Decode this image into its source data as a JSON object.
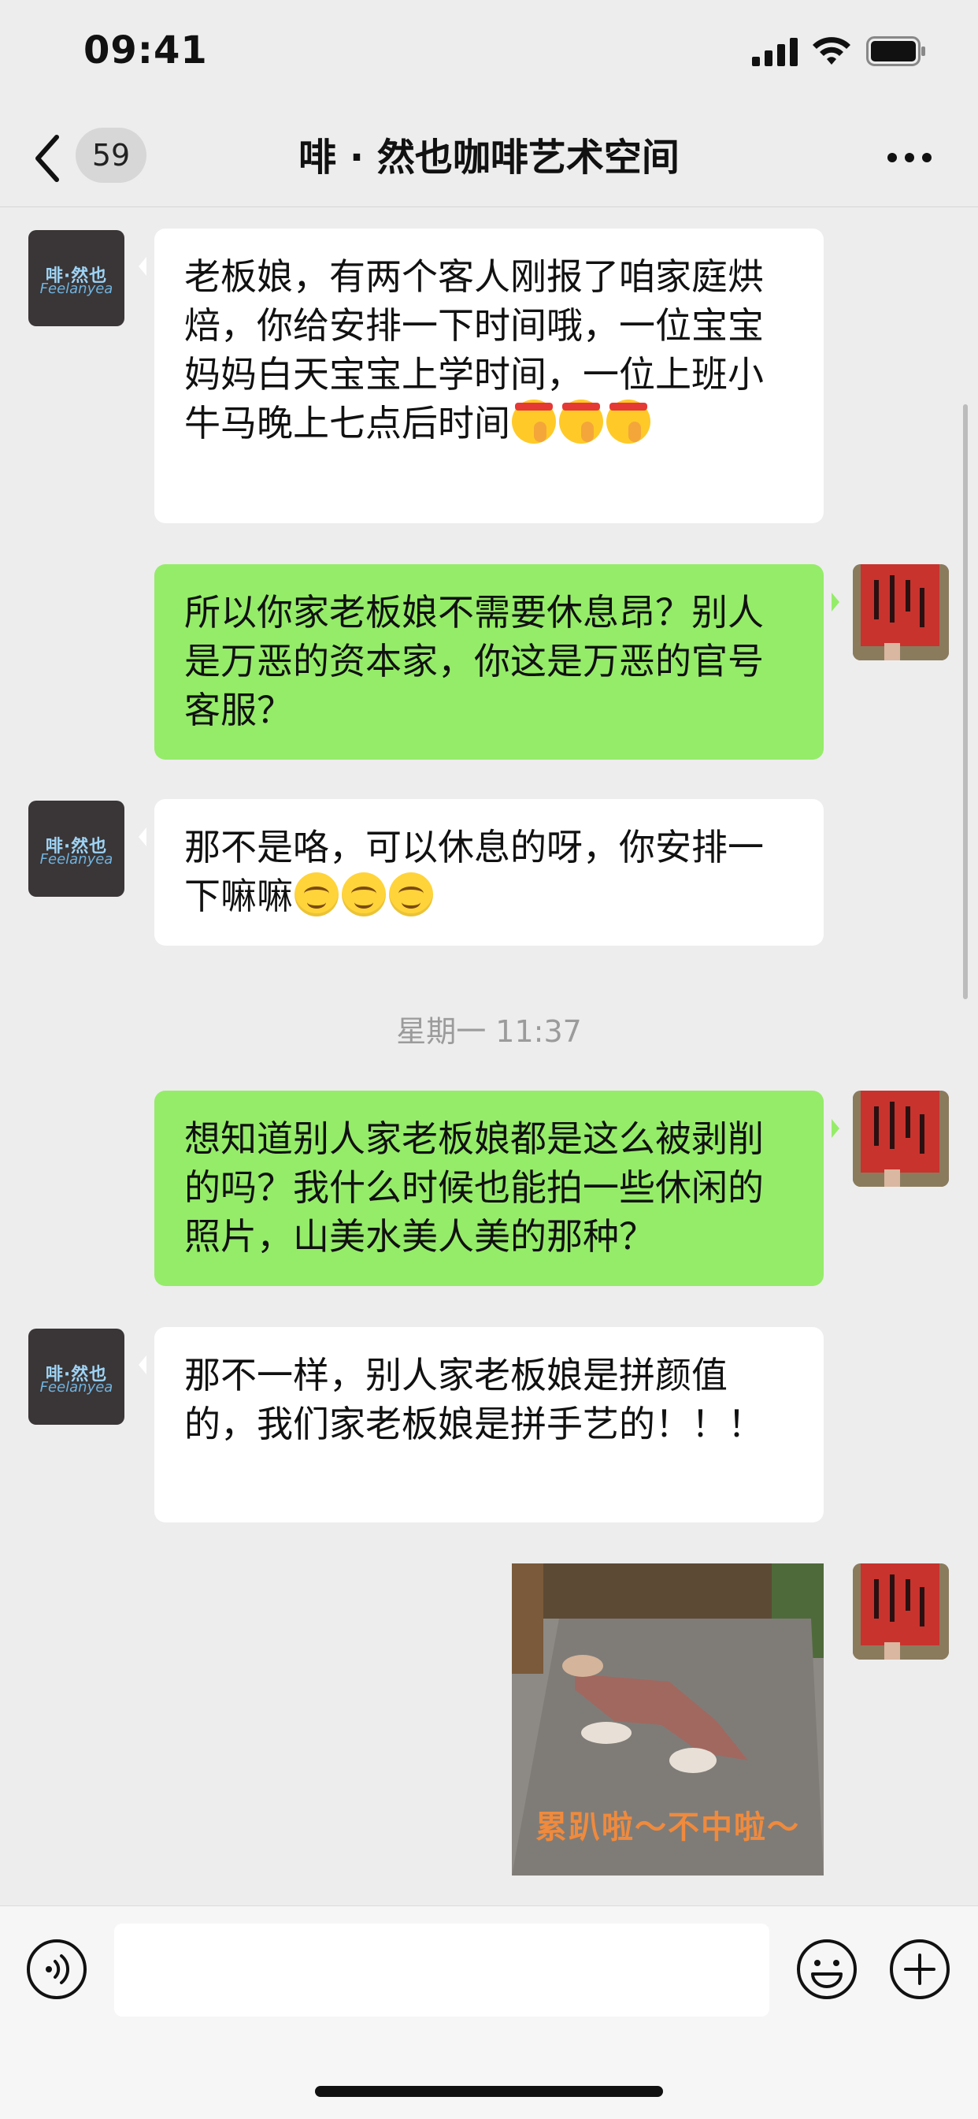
{
  "status_bar": {
    "time": "09:41"
  },
  "nav": {
    "back_icon": "chevron-left-icon",
    "unread_count": "59",
    "title": "啡 · 然也咖啡艺术空间",
    "more_icon": "more-dots-icon"
  },
  "contact_avatar": {
    "logo_cn": "啡·然也",
    "logo_en": "Feelanyea"
  },
  "messages": [
    {
      "side": "left",
      "text": "老板娘，有两个客人刚报了咱家庭烘焙，你给安排一下时间哦，一位宝宝妈妈白天宝宝上学时间，一位上班小牛马晚上七点后时间"
    },
    {
      "side": "right",
      "text": "所以你家老板娘不需要休息昂？别人是万恶的资本家，你这是万恶的官号客服？"
    },
    {
      "side": "left",
      "text": "那不是咯，可以休息的呀，你安排一下嘛嘛"
    },
    {
      "side": "right",
      "text": "想知道别人家老板娘都是这么被剥削的吗？我什么时候也能拍一些休闲的照片，山美水美人美的那种？"
    },
    {
      "side": "left",
      "text": "那不一样，别人家老板娘是拼颜值的，我们家老板娘是拼手艺的！！！"
    },
    {
      "side": "right",
      "type": "image",
      "caption": "累趴啦～不中啦～"
    }
  ],
  "timestamp": "星期一 11:37",
  "input_bar": {
    "voice_icon": "voice-icon",
    "emoji_icon": "emoji-icon",
    "plus_icon": "plus-icon",
    "placeholder": ""
  }
}
